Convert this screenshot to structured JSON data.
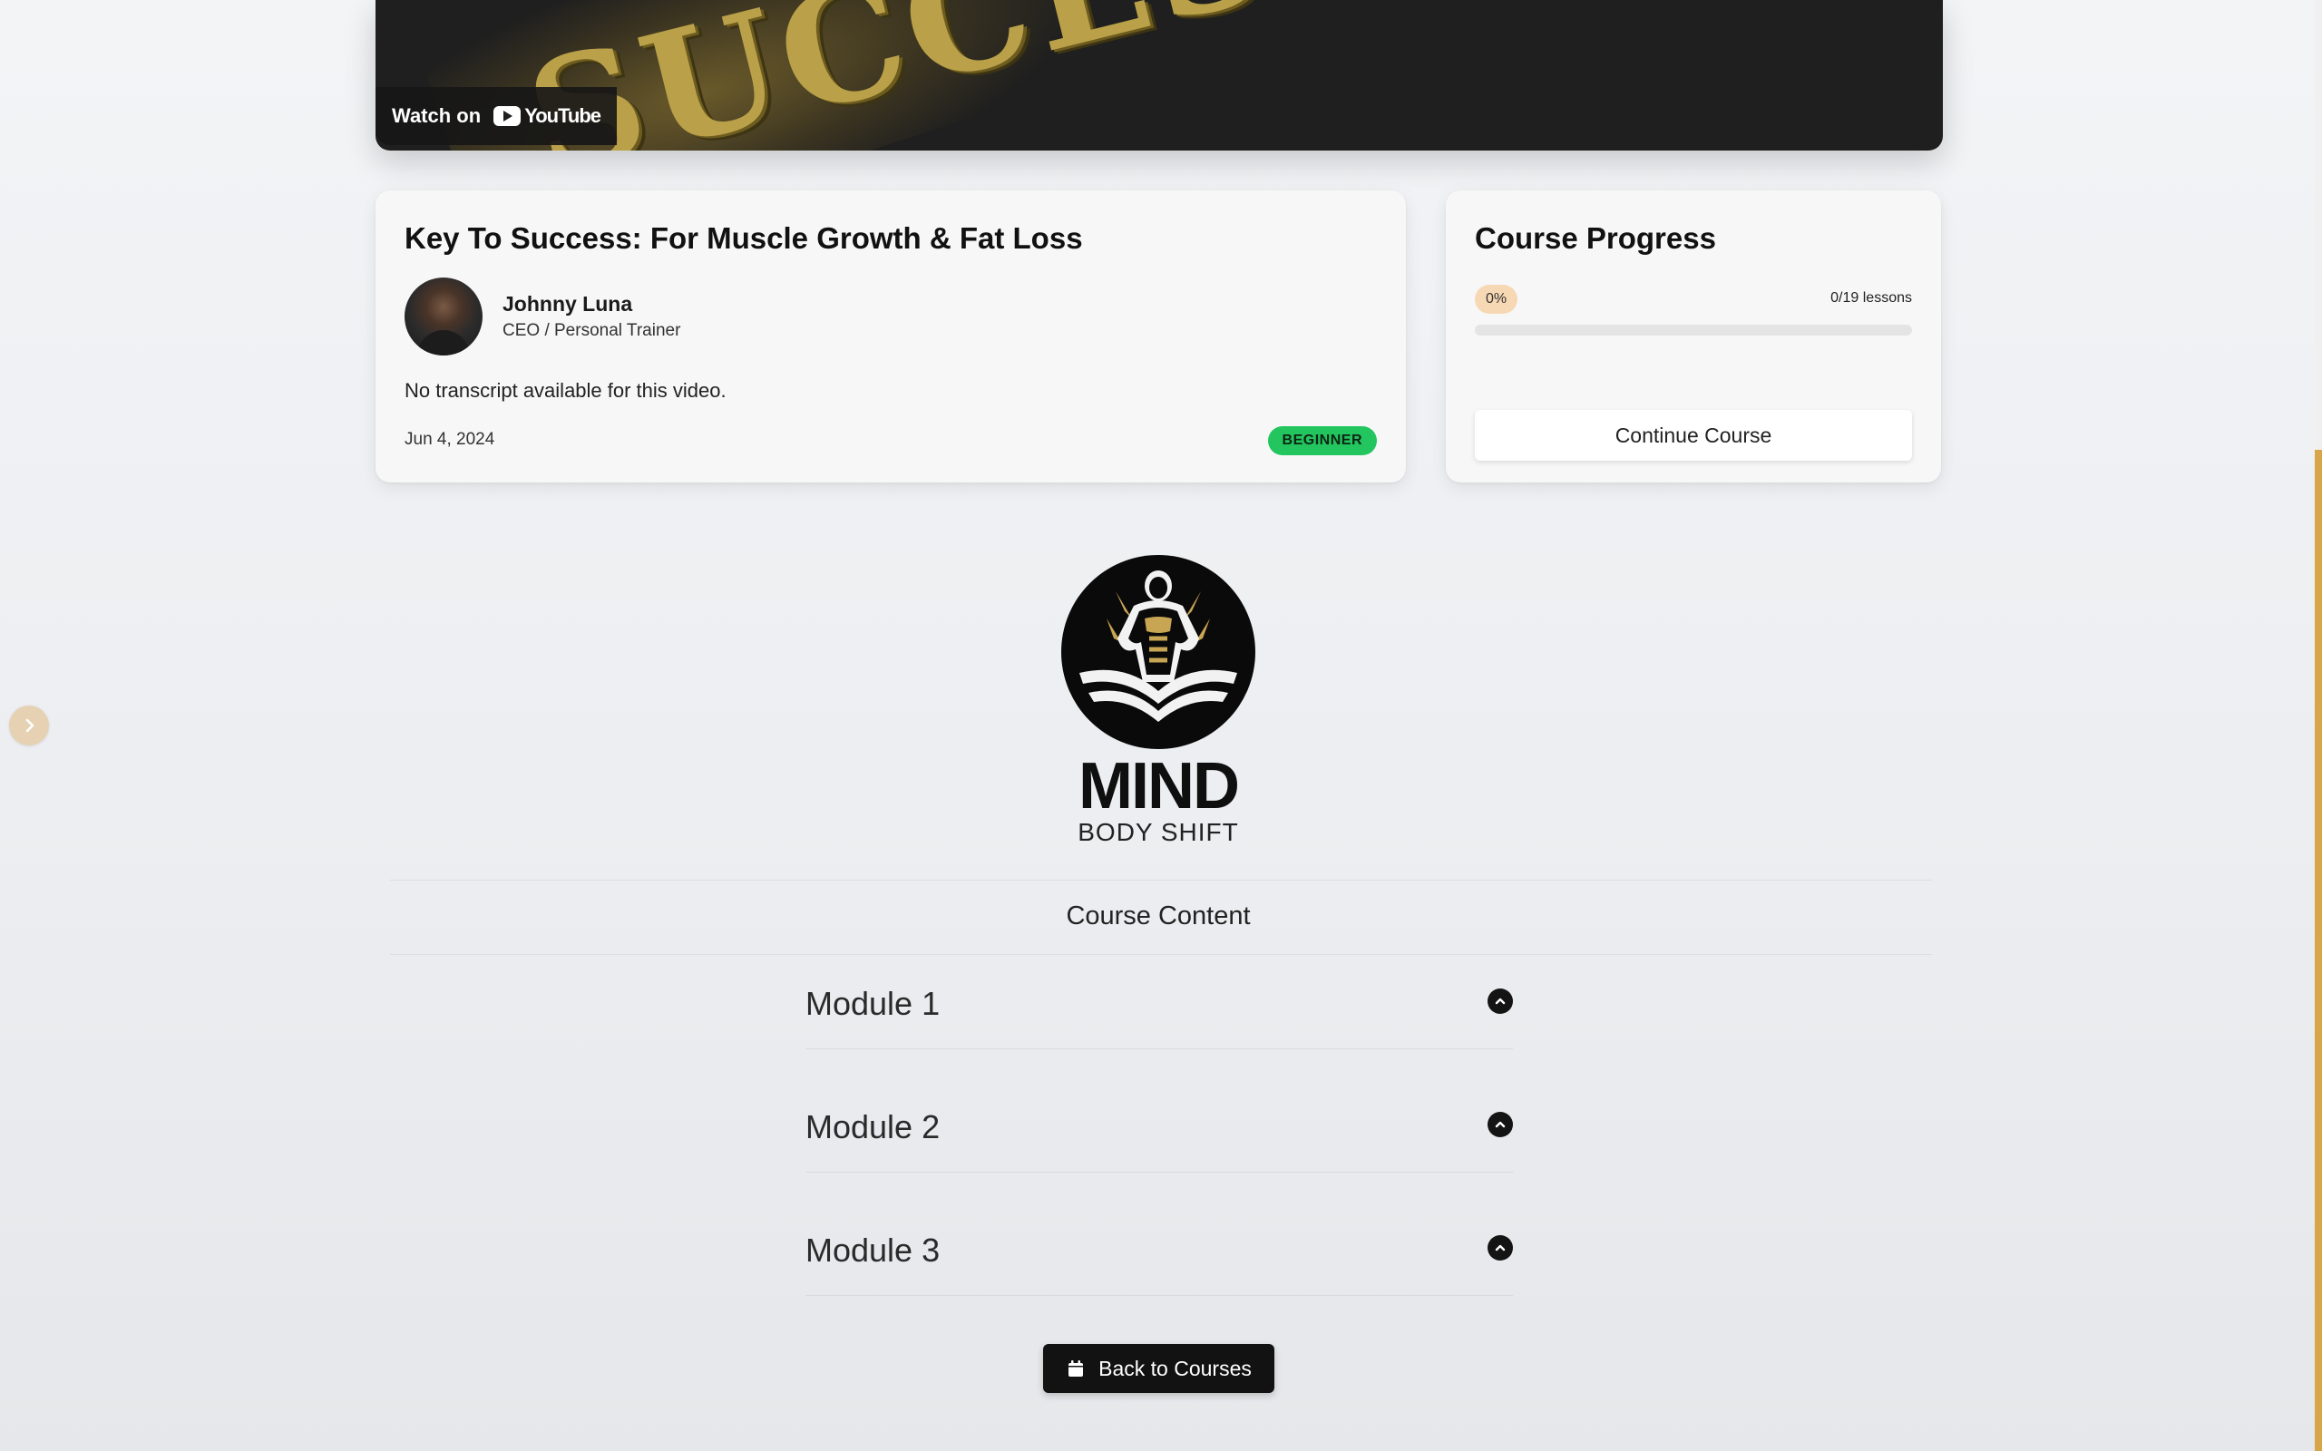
{
  "video": {
    "art_text": "SUCCESS",
    "watch_on_label": "Watch on",
    "platform_name": "YouTube"
  },
  "lesson": {
    "title": "Key To Success: For Muscle Growth & Fat Loss",
    "author_name": "Johnny Luna",
    "author_role": "CEO / Personal Trainer",
    "transcript_text": "No transcript available for this video.",
    "date": "Jun 4, 2024",
    "level": "BEGINNER",
    "level_color": "#22c55e"
  },
  "progress": {
    "title": "Course Progress",
    "percent_label": "0%",
    "percent_value": 0,
    "lessons_label": "0/19 lessons",
    "completed_lessons": 0,
    "total_lessons": 19,
    "continue_label": "Continue Course",
    "accent_color": "#e8b64f"
  },
  "brand": {
    "name": "MIND",
    "tagline": "BODY SHIFT",
    "gold_color": "#c8a553"
  },
  "course_content": {
    "title": "Course Content",
    "modules": [
      {
        "label": "Module 1",
        "icon": "chevron-up-icon"
      },
      {
        "label": "Module 2",
        "icon": "chevron-up-icon"
      },
      {
        "label": "Module 3",
        "icon": "chevron-up-icon"
      }
    ]
  },
  "navigation": {
    "back_label": "Back to Courses",
    "back_icon": "calendar-icon",
    "side_toggle_icon": "chevron-right-icon"
  }
}
